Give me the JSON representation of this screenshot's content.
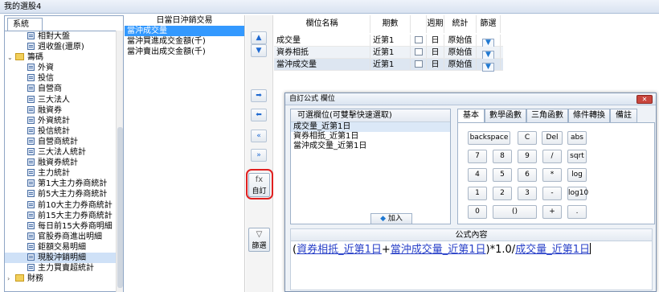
{
  "window": {
    "title": "我的選股4"
  },
  "left_panel": {
    "tab": "系統",
    "tree": [
      {
        "type": "leaf",
        "label": "相對大盤"
      },
      {
        "type": "leaf",
        "label": "週收盤(還原)"
      },
      {
        "type": "folder",
        "label": "籌碼",
        "expanded": true
      },
      {
        "type": "leaf",
        "label": "外資"
      },
      {
        "type": "leaf",
        "label": "投信"
      },
      {
        "type": "leaf",
        "label": "自營商"
      },
      {
        "type": "leaf",
        "label": "三大法人"
      },
      {
        "type": "leaf",
        "label": "融資券"
      },
      {
        "type": "leaf",
        "label": "外資統計"
      },
      {
        "type": "leaf",
        "label": "投信統計"
      },
      {
        "type": "leaf",
        "label": "自營商統計"
      },
      {
        "type": "leaf",
        "label": "三大法人統計"
      },
      {
        "type": "leaf",
        "label": "融資券統計"
      },
      {
        "type": "leaf",
        "label": "主力統計"
      },
      {
        "type": "leaf",
        "label": "第1大主力券商統計"
      },
      {
        "type": "leaf",
        "label": "前5大主力券商統計"
      },
      {
        "type": "leaf",
        "label": "前10大主力券商統計"
      },
      {
        "type": "leaf",
        "label": "前15大主力券商統計"
      },
      {
        "type": "leaf",
        "label": "每日前15大券商明細"
      },
      {
        "type": "leaf",
        "label": "官股券商進出明細"
      },
      {
        "type": "leaf",
        "label": "鉅額交易明細"
      },
      {
        "type": "leaf",
        "label": "現股沖銷明細",
        "selected": true
      },
      {
        "type": "leaf",
        "label": "主力買賣超統計"
      },
      {
        "type": "folder",
        "label": "財務",
        "expanded": false
      }
    ]
  },
  "mid_panel": {
    "header": "日當日沖銷交易",
    "items": [
      {
        "label": "當沖成交量",
        "selected": true
      },
      {
        "label": "當沖買進成交金額(千)"
      },
      {
        "label": "當沖賣出成交金額(千)"
      }
    ]
  },
  "button_col": {
    "up_icon": "arrow-up-icon",
    "down_icon": "arrow-down-icon",
    "custom_formula_icon": "fx",
    "custom_formula_label": "自訂",
    "filter_label": "篩選"
  },
  "table": {
    "headers": [
      "欄位名稱",
      "期數",
      "",
      "週期",
      "統計",
      "篩選"
    ],
    "rows": [
      {
        "name": "成交量",
        "period": "近第1",
        "cycle": "日",
        "stat": "原始值"
      },
      {
        "name": "資券相抵",
        "period": "近第1",
        "cycle": "日",
        "stat": "原始值"
      },
      {
        "name": "當沖成交量",
        "period": "近第1",
        "cycle": "日",
        "stat": "原始值"
      }
    ]
  },
  "dialog": {
    "title": "自訂公式 欄位",
    "field_list_header": "可選欄位(可雙擊快速選取)",
    "fields": [
      "成交量_近第1日",
      "資券相抵_近第1日",
      "當沖成交量_近第1日"
    ],
    "add_label": "加入",
    "tabs": [
      "基本",
      "數學函數",
      "三角函數",
      "條件轉換",
      "備註"
    ],
    "keys": {
      "backspace": "backspace",
      "c": "C",
      "del": "Del",
      "abs": "abs",
      "k7": "7",
      "k8": "8",
      "k9": "9",
      "div": "/",
      "sqrt": "sqrt",
      "k4": "4",
      "k5": "5",
      "k6": "6",
      "mul": "*",
      "log": "log",
      "k1": "1",
      "k2": "2",
      "k3": "3",
      "sub": "-",
      "log10": "log10",
      "k0": "0",
      "paren": "()",
      "add": "+",
      "dot": "."
    },
    "formula_header": "公式內容",
    "formula": {
      "open": "(",
      "t1": "資券相抵_近第1日",
      "plus": "+",
      "t2": "當沖成交量_近第1日",
      "mid": ")*1.0/",
      "t3": "成交量_近第1日"
    }
  }
}
